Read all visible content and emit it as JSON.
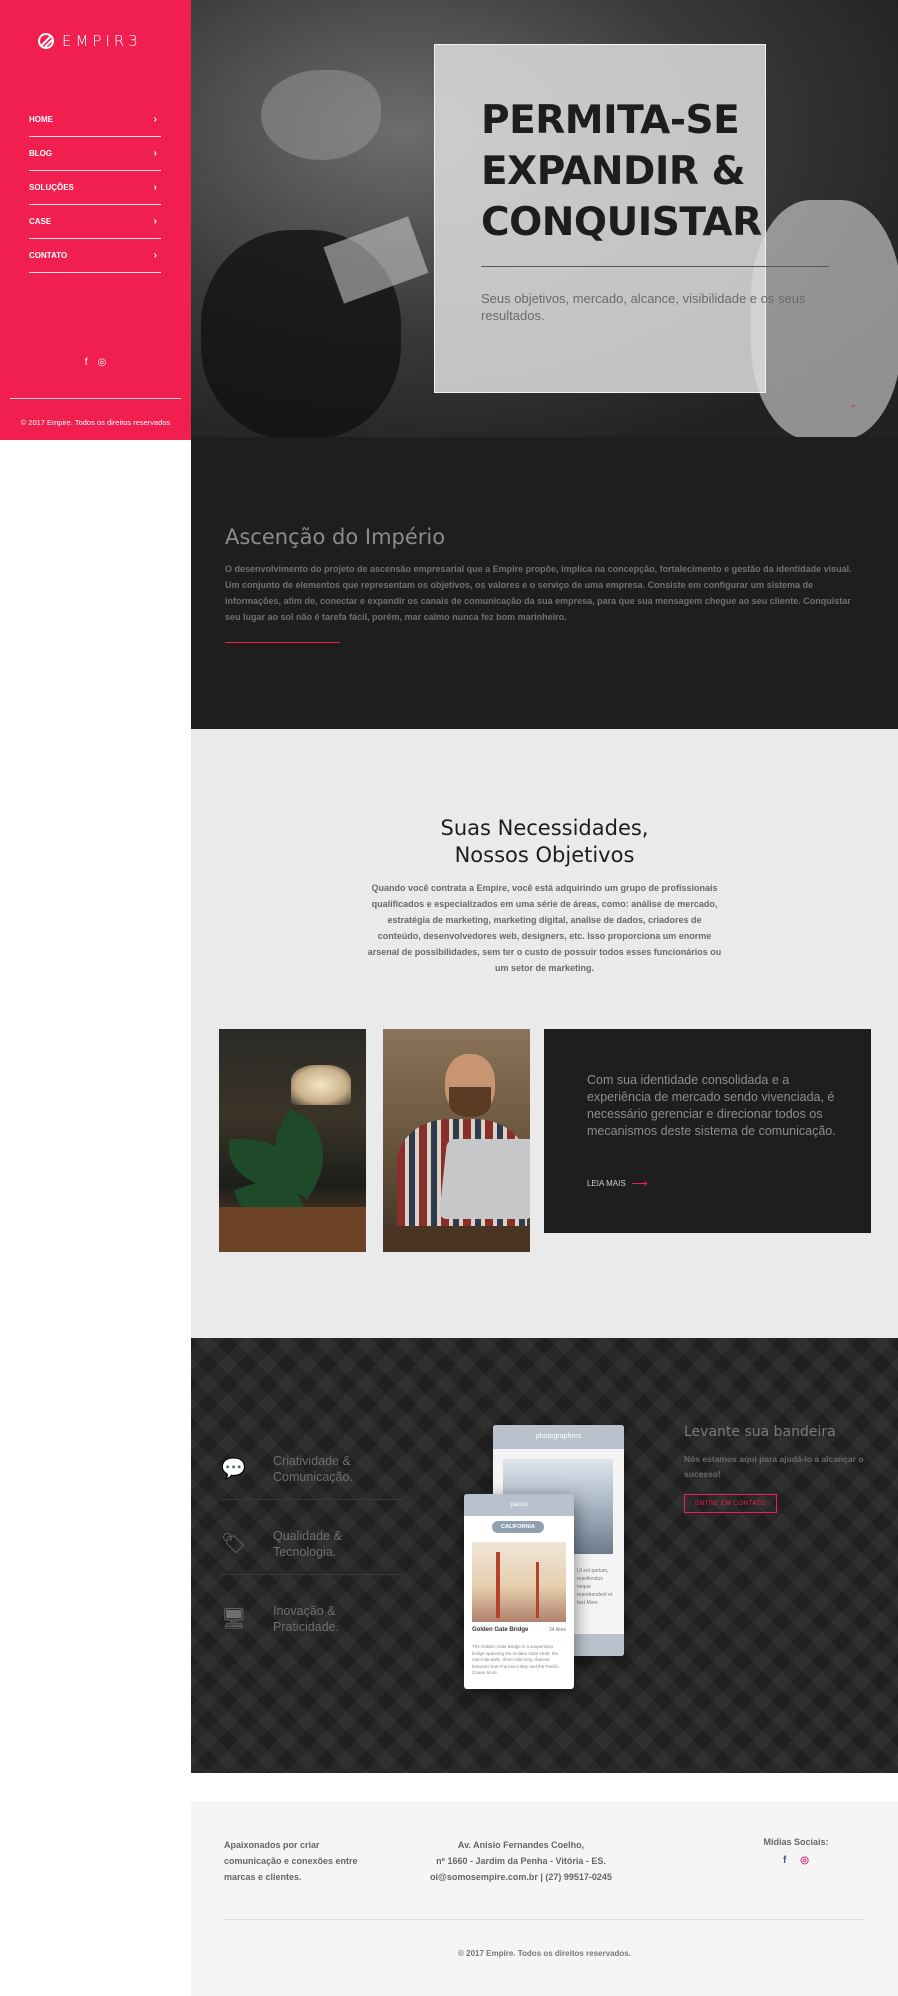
{
  "brand": {
    "name": "EMPIR3"
  },
  "sidebar": {
    "nav": [
      {
        "label": "HOME"
      },
      {
        "label": "BLOG"
      },
      {
        "label": "SOLUÇÕES"
      },
      {
        "label": "CASE"
      },
      {
        "label": "CONTATO"
      }
    ],
    "social_icons": [
      "facebook-icon",
      "instagram-icon"
    ],
    "copyright": "© 2017 Empire. Todos os direitos reservados",
    "colors": {
      "background": "#f01f4f"
    }
  },
  "hero": {
    "title": "PERMITA-SE EXPANDIR & CONQUISTAR",
    "subtitle": "Seus objetivos, mercado, alcance, visibilidade e os seus resultados."
  },
  "about": {
    "title": "Ascenção do Império",
    "body": "O desenvolvimento do projeto de ascensão empresarial que a Empire propõe, implica na concepção, fortalecimento e gestão da identidade visual. Um conjunto de elementos que representam os objetivos, os valores e o serviço de uma empresa. Consiste em configurar um sistema de informações, afim de, conectar e expandir os canais de comunicação da sua empresa, para que sua mensagem chegue ao seu cliente. Conquistar seu lugar ao sol não é tarefa fácil, porém, mar calmo nunca fez bom marinheiro."
  },
  "needs": {
    "title_line1": "Suas Necessidades,",
    "title_line2": "Nossos Objetivos",
    "body": "Quando você contrata a Empire, você está adquirindo um grupo de profissionais qualificados e especializados em uma série de áreas, como: análise de mercado, estratégia de marketing, marketing digital, analise de dados, criadores de conteúdo, desenvolvedores web, designers, etc. Isso proporciona um enorme arsenal de possibilidades, sem ter o custo de possuir todos esses funcionários ou um setor de marketing.",
    "card_text": "Com sua identidade consolidada e a experiência de mercado sendo vivenciada, é necessário gerenciar e direcionar todos os mecanismos deste sistema de comunicação.",
    "card_link": "LEIA MAIS"
  },
  "features": {
    "items": [
      {
        "line1": "Criatividade &",
        "line2": "Comunicação.",
        "icon": "chat-bubbles-icon"
      },
      {
        "line1": "Qualidade &",
        "line2": "Tecnologia.",
        "icon": "tags-icon"
      },
      {
        "line1": "Inovação &",
        "line2": "Praticidade.",
        "icon": "monitor-icon"
      }
    ],
    "mockup": {
      "back_header": "photographers",
      "front_header": "places",
      "front_pill": "CALIFORNIA",
      "front_title": "Golden Gate Bridge",
      "front_likes": "34 likes",
      "front_desc": "The Golden Gate Bridge is a suspension bridge spanning the Golden Gate strait, the one-mile-wide, three-mile-long channel between San Francisco Bay and the Pacific Ocean More",
      "back_side_text": "Ut est partum, repellendus neque reprehenderit et fast More"
    },
    "cta_title": "Levante sua bandeira",
    "cta_body": "Nós estamos aqui para ajudá-lo a alcançar o sucesso!",
    "cta_button": "ENTRE EM CONTATO"
  },
  "footer": {
    "tagline": "Apaixonados por criar comunicação e conexões entre marcas e clientes.",
    "address_line1": "Av. Anisio Fernandes Coelho,",
    "address_line2": "nº 1660 - Jardim da Penha - Vitória - ES.",
    "address_line3": "oi@somosempire.com.br | (27) 99517-0245",
    "social_label": "Mídias Sociais:",
    "social_icons": [
      "facebook-icon",
      "instagram-icon"
    ],
    "copyright": "© 2017 Empire. Todos os direitos reservados."
  },
  "colors": {
    "accent": "#f01f4f",
    "dark": "#1e1e1e",
    "light": "#eaeaea"
  }
}
